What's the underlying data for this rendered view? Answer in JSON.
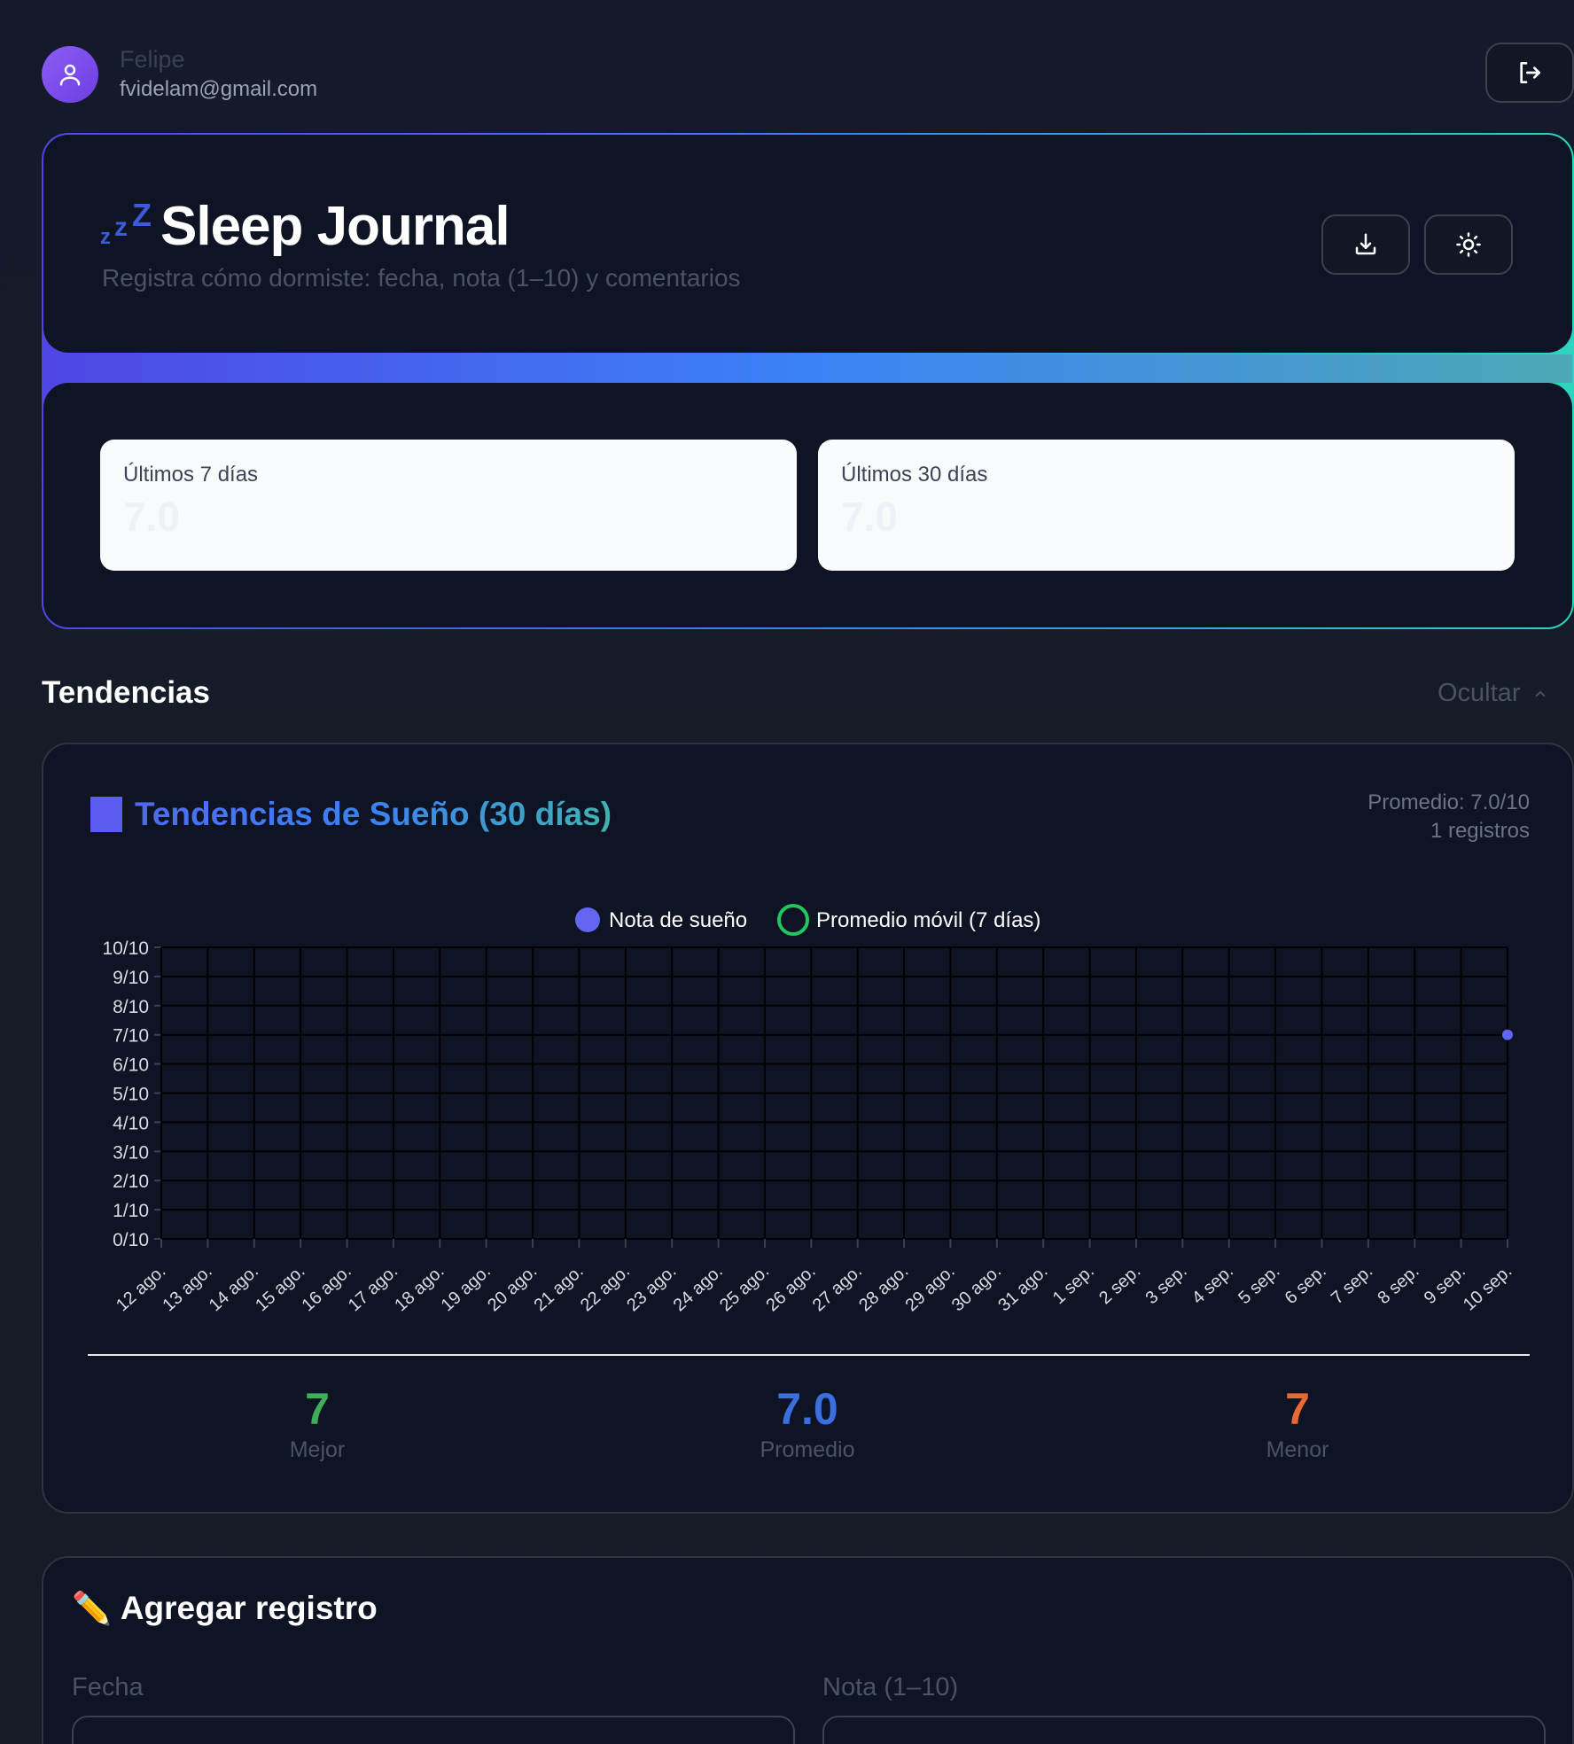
{
  "user": {
    "name": "Felipe",
    "email": "fvidelam@gmail.com"
  },
  "header": {
    "title": "Sleep Journal",
    "subtitle": "Registra cómo dormiste: fecha, nota (1–10) y comentarios",
    "icons": [
      "zzz-icon",
      "download-icon",
      "sun-icon",
      "logout-icon"
    ]
  },
  "stats": [
    {
      "label": "Últimos 7 días",
      "value": "7.0"
    },
    {
      "label": "Últimos 30 días",
      "value": "7.0"
    }
  ],
  "trends": {
    "section_title": "Tendencias",
    "hide_label": "Ocultar",
    "card_title": "Tendencias de Sueño (30 días)",
    "average_text": "Promedio: 7.0/10",
    "count_text": "1 registros",
    "summary": [
      {
        "value": "7",
        "label": "Mejor",
        "color": "#3fae58"
      },
      {
        "value": "7.0",
        "label": "Promedio",
        "color": "#3b6fe0"
      },
      {
        "value": "7",
        "label": "Menor",
        "color": "#e86a33"
      }
    ]
  },
  "chart_data": {
    "type": "line",
    "legend": [
      {
        "name": "Nota de sueño",
        "color": "#6366f1",
        "style": "filled"
      },
      {
        "name": "Promedio móvil (7 días)",
        "color": "#22c55e",
        "style": "outline"
      }
    ],
    "legend_position": "top-center",
    "x": [
      "12 ago.",
      "13 ago.",
      "14 ago.",
      "15 ago.",
      "16 ago.",
      "17 ago.",
      "18 ago.",
      "19 ago.",
      "20 ago.",
      "21 ago.",
      "22 ago.",
      "23 ago.",
      "24 ago.",
      "25 ago.",
      "26 ago.",
      "27 ago.",
      "28 ago.",
      "29 ago.",
      "30 ago.",
      "31 ago.",
      "1 sep.",
      "2 sep.",
      "3 sep.",
      "4 sep.",
      "5 sep.",
      "6 sep.",
      "7 sep.",
      "8 sep.",
      "9 sep.",
      "10 sep."
    ],
    "y_ticks": [
      "0/10",
      "1/10",
      "2/10",
      "3/10",
      "4/10",
      "5/10",
      "6/10",
      "7/10",
      "8/10",
      "9/10",
      "10/10"
    ],
    "ylim": [
      0,
      10
    ],
    "grid": true,
    "series": [
      {
        "name": "Nota de sueño",
        "values": [
          null,
          null,
          null,
          null,
          null,
          null,
          null,
          null,
          null,
          null,
          null,
          null,
          null,
          null,
          null,
          null,
          null,
          null,
          null,
          null,
          null,
          null,
          null,
          null,
          null,
          null,
          null,
          null,
          null,
          7
        ]
      }
    ]
  },
  "add_entry": {
    "title": "Agregar registro",
    "date_label": "Fecha",
    "score_label": "Nota (1–10)",
    "icons": [
      "pencil-icon"
    ]
  }
}
